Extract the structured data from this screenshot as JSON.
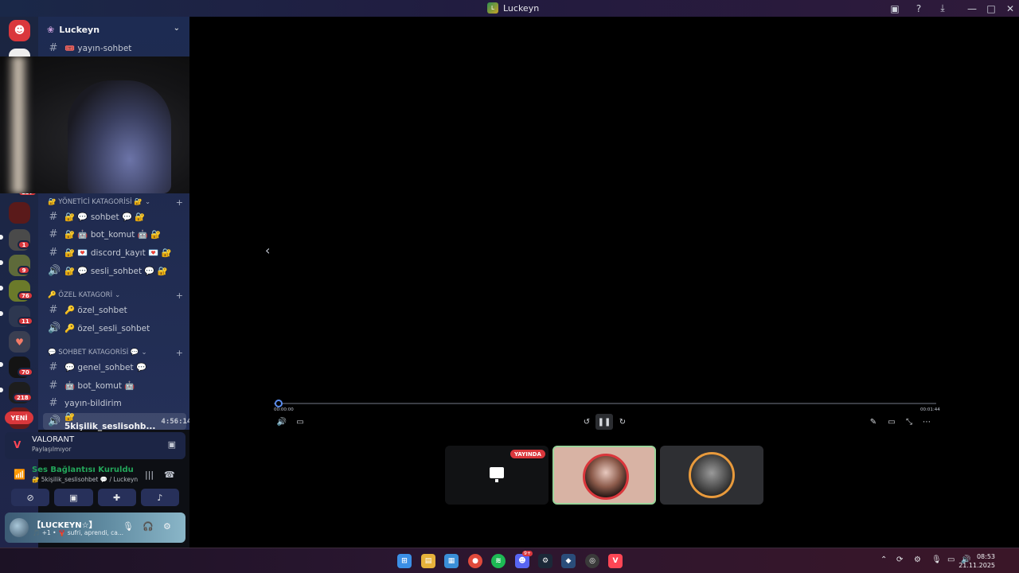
{
  "window": {
    "title": "Luckeyn"
  },
  "server": {
    "name": "Luckeyn"
  },
  "channels": {
    "top": "🎟️ yayın-sohbet",
    "cat_admin": "🔐 YÖNETİCİ KATAGORİSİ 🔐",
    "admin_items": [
      "🔐 💬 sohbet 💬 🔐",
      "🔐 🤖 bot_komut 🤖 🔐",
      "🔐 💌 discord_kayıt 💌 🔐",
      "🔐 💬 sesli_sohbet 💬 🔐"
    ],
    "cat_private": "🔑 ÖZEL KATAGORİ",
    "private_items": [
      "🔑 özel_sohbet",
      "🔑 özel_sesli_sohbet"
    ],
    "cat_chat": "💬 SOHBET KATAGORİSİ 💬",
    "chat_items": [
      "💬 genel_sohbet 💬",
      "🤖 bot_komut 🤖",
      "yayın-bildirim"
    ],
    "voice_active": "🔐 5kişilik_seslisohb...",
    "voice_time": "4:56:14"
  },
  "server_badges": [
    "1",
    "9",
    "76",
    "11",
    "70",
    "218",
    "157"
  ],
  "new_label": "YENİ",
  "activity": {
    "game": "VALORANT",
    "status": "Paylaşılmıyor"
  },
  "voice": {
    "connected": "Ses Bağlantısı Kuruldu",
    "path": "🔐 5kişilik_seslisohbet 💬 / Luckeyn"
  },
  "user": {
    "name": "【LUCKEYN☆】",
    "status": "🎵 +1 • 🦞 sufri, aprendi, ca..."
  },
  "player": {
    "time_start": "00:00:00",
    "time_end": "00:01:44"
  },
  "tiles": {
    "live_label": "YAYINDA"
  },
  "clock": {
    "time": "08:53",
    "date": "21.11.2025"
  },
  "taskbar_badge": "9+",
  "colors": {
    "accent": "#5865f2",
    "live": "#da373c",
    "connected": "#23a55a"
  }
}
